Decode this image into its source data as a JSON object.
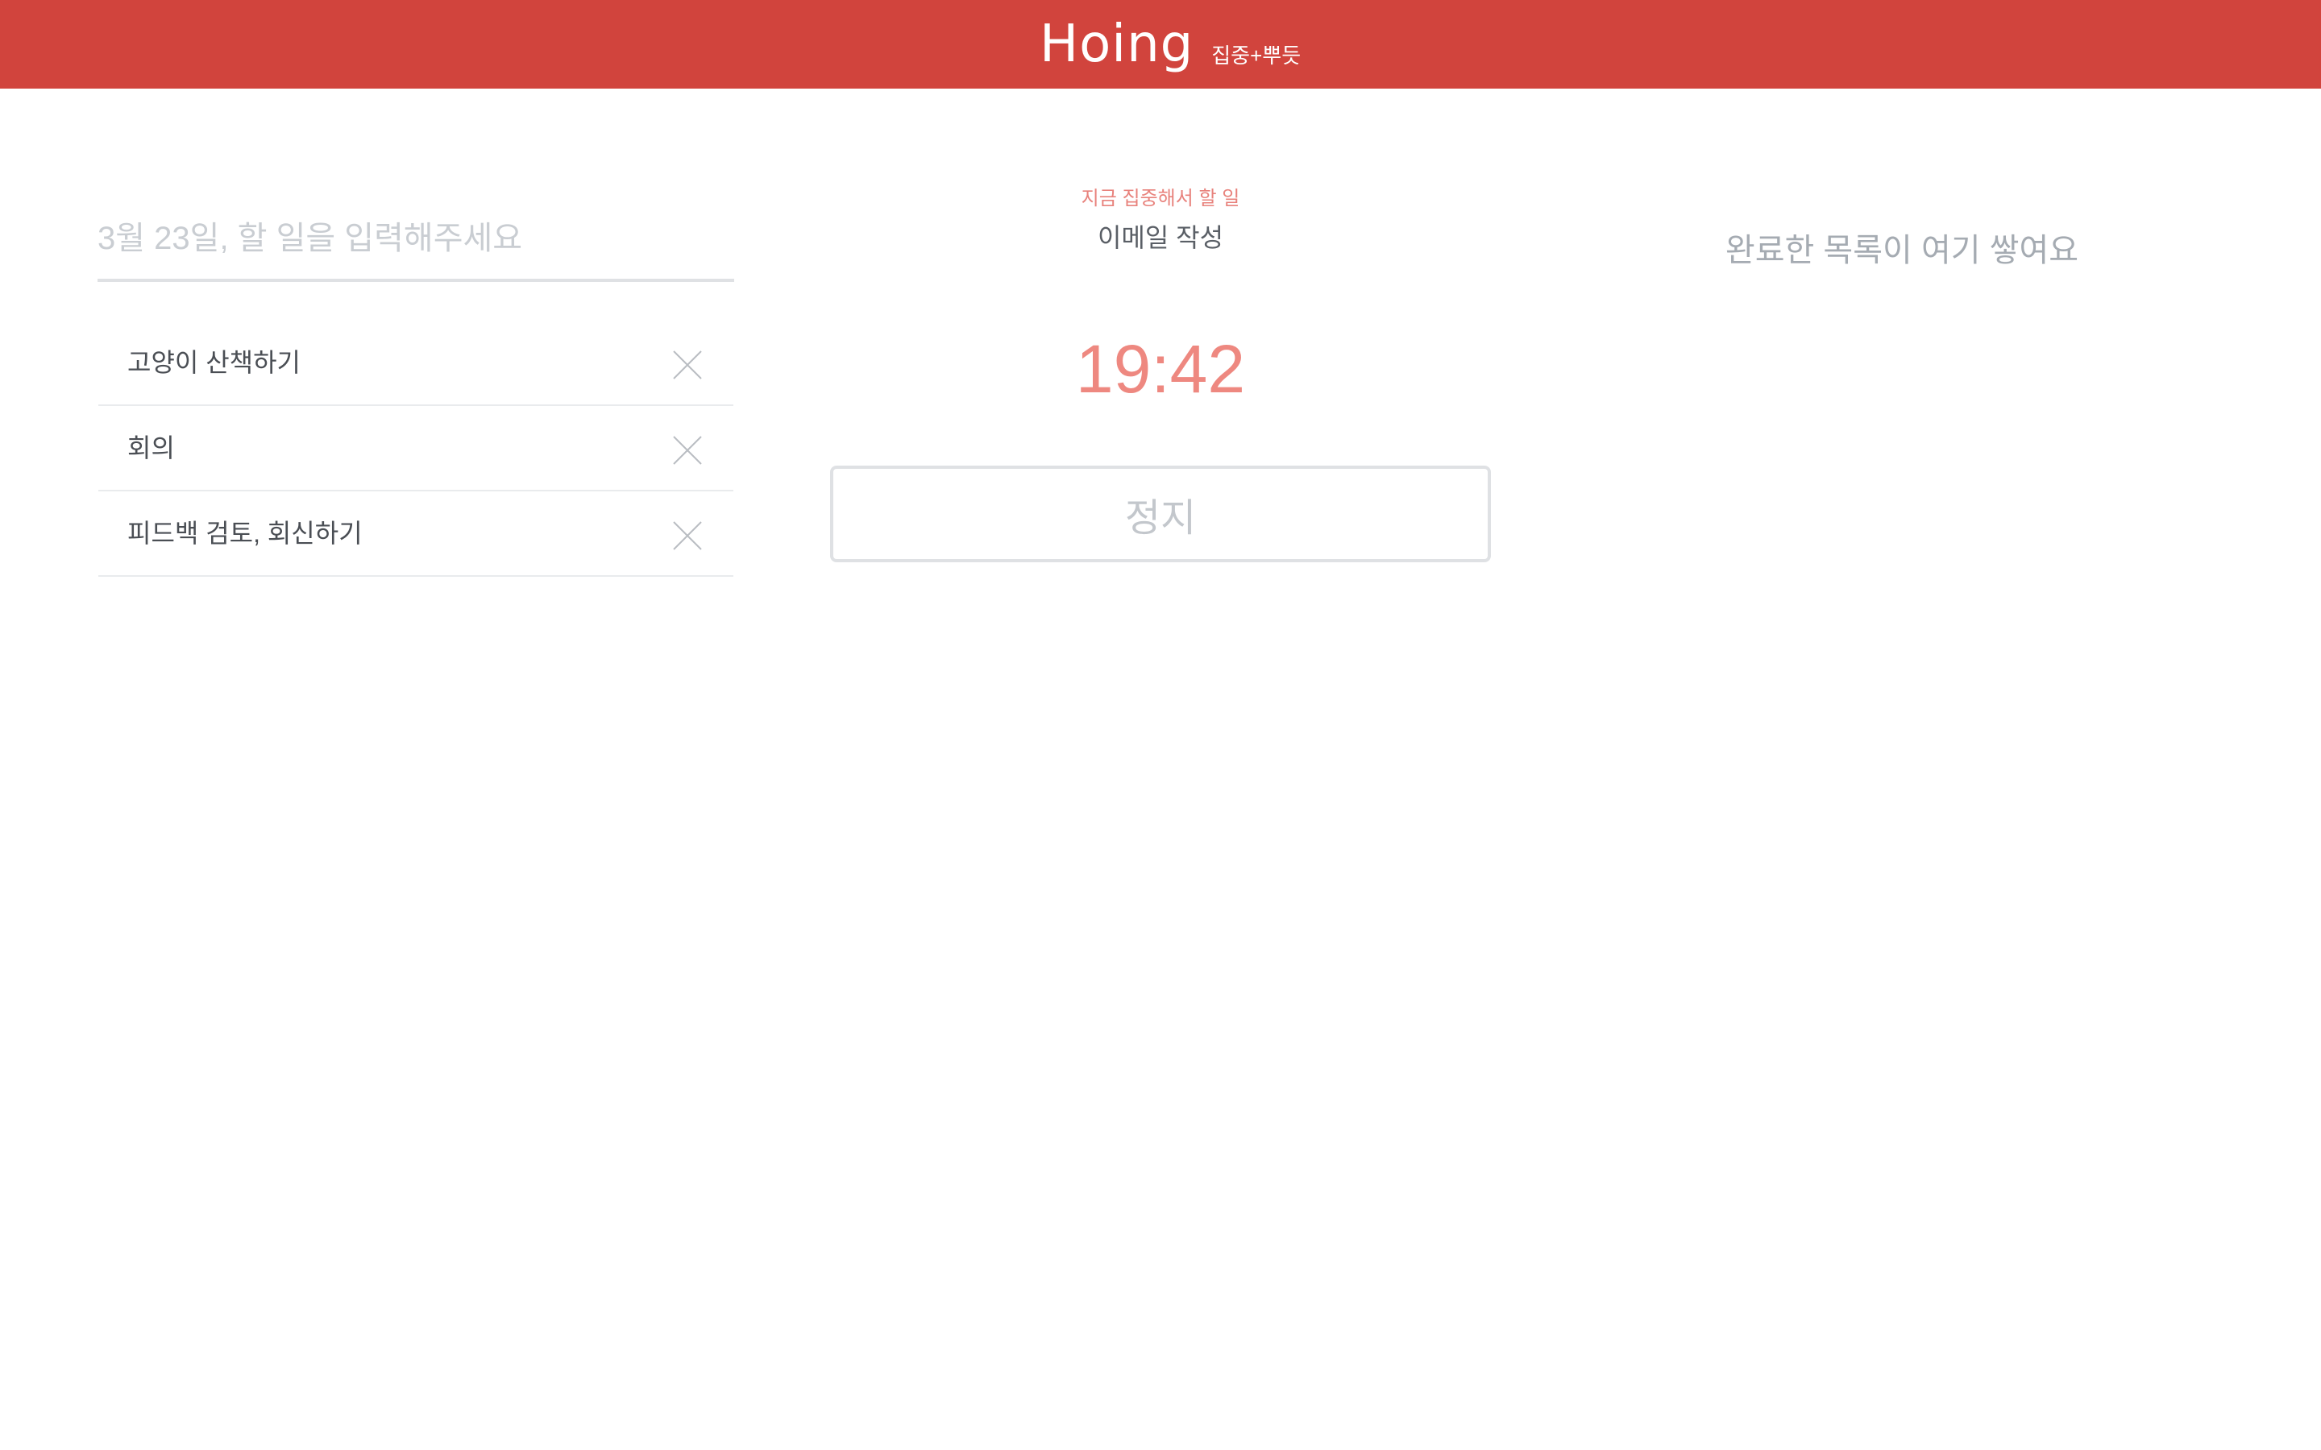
{
  "header": {
    "logo": "Hoing",
    "tagline": "집중+뿌듯",
    "background_color": "#d1443d"
  },
  "todo": {
    "input_placeholder": "3월 23일, 할 일을 입력해주세요",
    "input_value": "",
    "items": [
      {
        "label": "고양이 산책하기",
        "delete_icon": "close-icon"
      },
      {
        "label": "회의",
        "delete_icon": "close-icon"
      },
      {
        "label": "피드백 검토, 회신하기",
        "delete_icon": "close-icon"
      }
    ]
  },
  "focus": {
    "label": "지금 집중해서 할 일",
    "current_task": "이메일 작성",
    "timer": "19:42",
    "stop_label": "정지",
    "accent_color": "#ee8880"
  },
  "done": {
    "placeholder": "완료한 목록이 여기 쌓여요"
  }
}
